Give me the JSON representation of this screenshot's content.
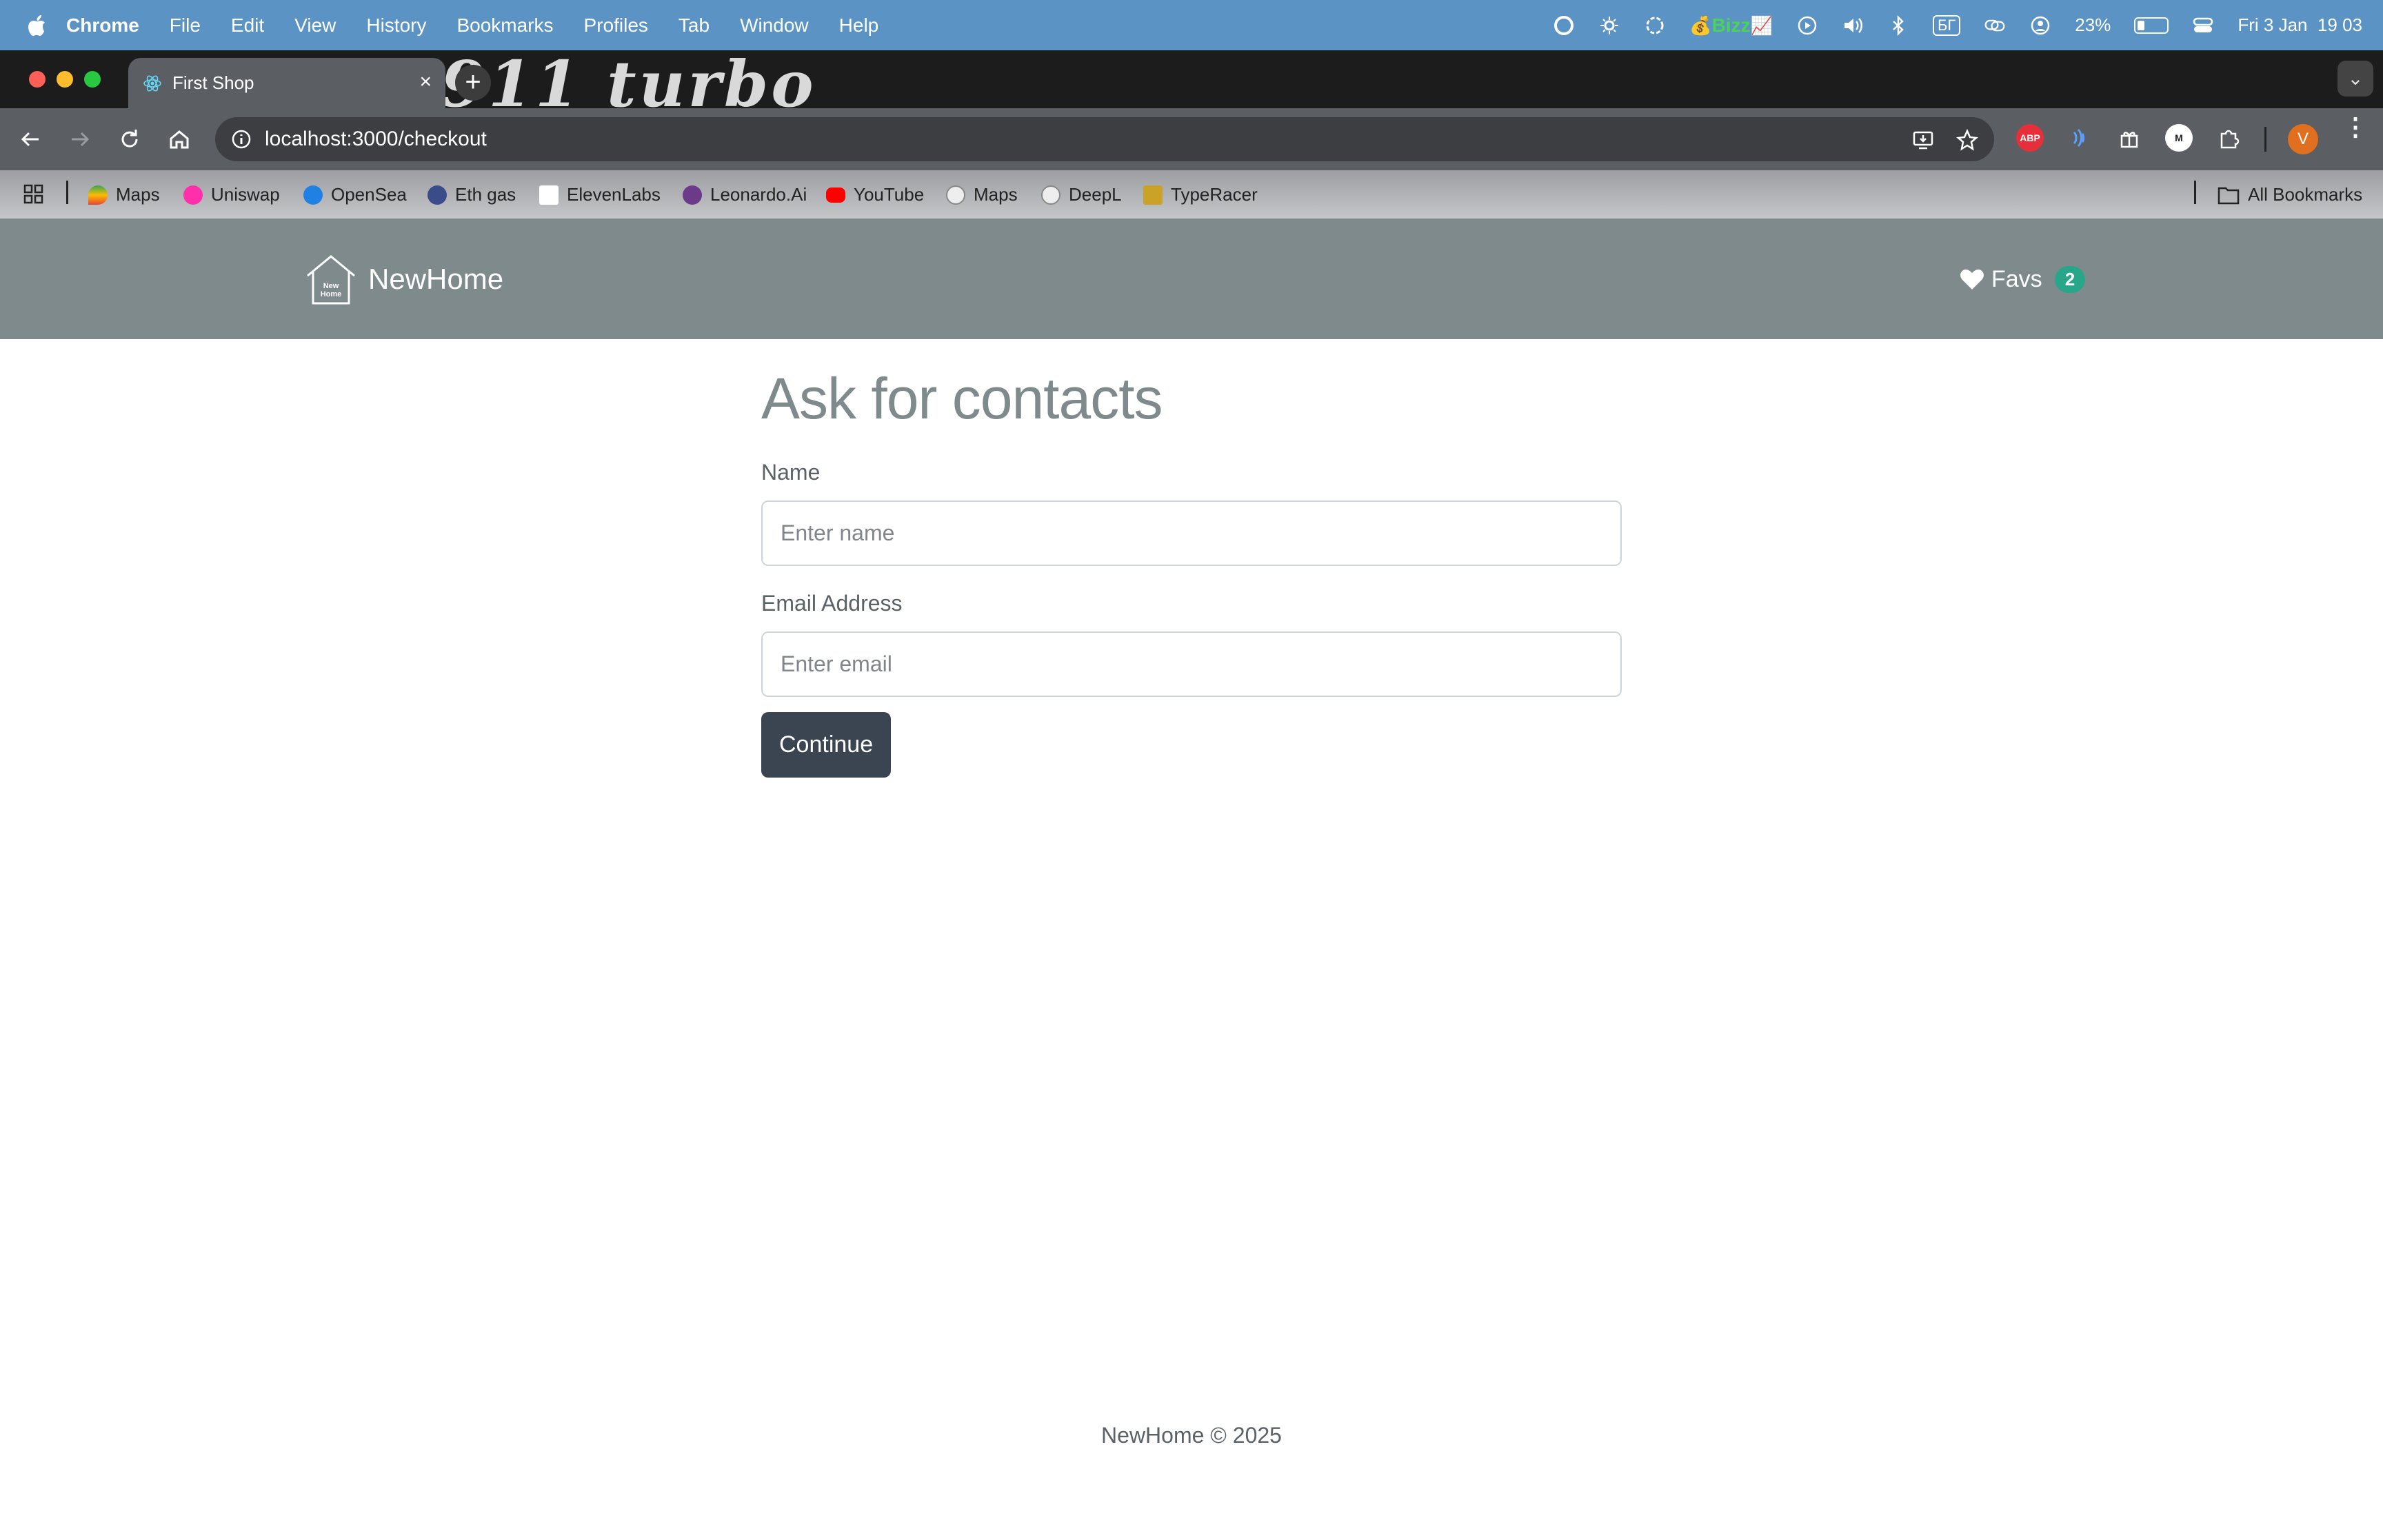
{
  "menubar": {
    "app": "Chrome",
    "items": [
      "File",
      "Edit",
      "View",
      "History",
      "Bookmarks",
      "Profiles",
      "Tab",
      "Window",
      "Help"
    ],
    "status": {
      "bizz": "Bizz",
      "battery": "23%",
      "battery_level": 0.23,
      "datetime": "Fri 3 Jan  19 03",
      "keyboard": "БГ"
    }
  },
  "browser": {
    "tab_title": "First Shop",
    "new_tab": "+",
    "theme_text": "911 turbo",
    "url": "localhost:3000/checkout",
    "profile_initial": "V",
    "extensions": [
      "ABP"
    ],
    "bookmarks": [
      "Maps",
      "Uniswap",
      "OpenSea",
      "Eth gas",
      "ElevenLabs",
      "Leonardo.Ai",
      "YouTube",
      "Maps",
      "DeepL",
      "TypeRacer"
    ],
    "all_bookmarks": "All Bookmarks"
  },
  "page": {
    "brand": "NewHome",
    "logo_text": "New Home",
    "favs_label": "Favs",
    "favs_count": "2",
    "title": "Ask for contacts",
    "name_label": "Name",
    "name_placeholder": "Enter name",
    "email_label": "Email Address",
    "email_placeholder": "Enter email",
    "continue": "Continue",
    "footer": "NewHome © 2025"
  }
}
